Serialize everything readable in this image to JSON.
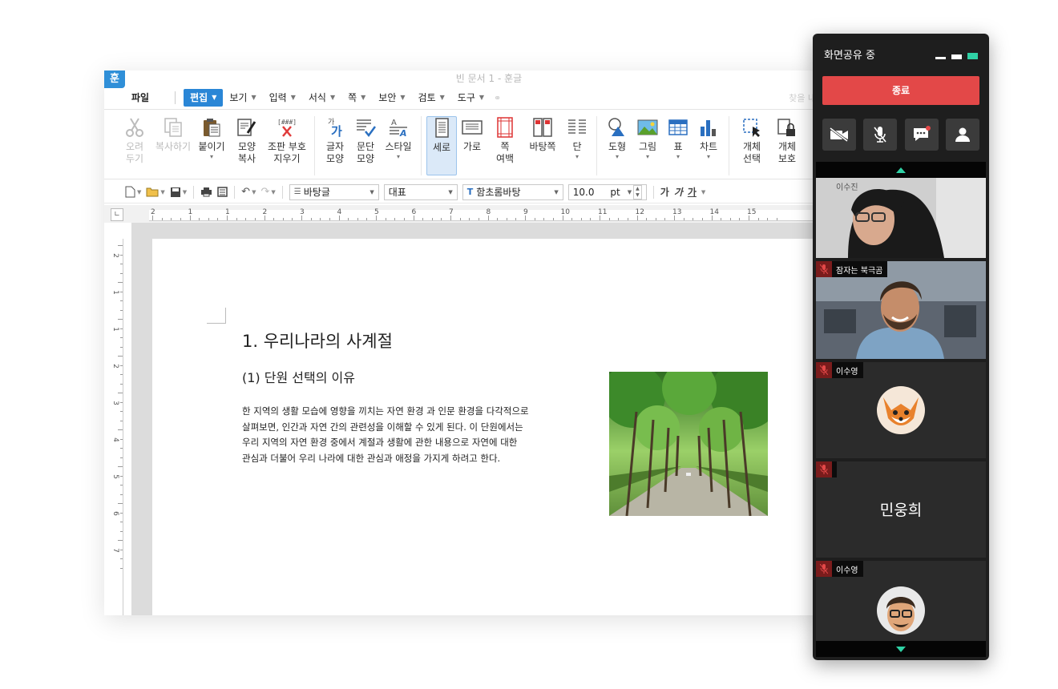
{
  "window": {
    "title": "빈 문서 1 - 훈글",
    "logo": "훈"
  },
  "menu": {
    "file": "파일",
    "items": [
      "편집",
      "보기",
      "입력",
      "서식",
      "쪽",
      "보안",
      "검토",
      "도구"
    ],
    "active": "편집",
    "right_hint": "찾을 내"
  },
  "ribbon": {
    "cut": "오려\n두기",
    "copy": "복사하기",
    "paste": "붙이기",
    "format_copy": "모양\n복사",
    "clear_marks": "조판 부호\n지우기",
    "char_shape": "글자\n모양",
    "para_shape": "문단\n모양",
    "style": "스타일",
    "portrait": "세로",
    "landscape": "가로",
    "page_margin": "쪽\n여백",
    "master_page": "바탕쪽",
    "columns": "단",
    "shapes": "도형",
    "picture": "그림",
    "table": "표",
    "chart": "차트",
    "obj_select": "개체\n선택",
    "obj_protect": "개체\n보호"
  },
  "toolbar": {
    "para_style": "바탕글",
    "lang": "대표",
    "font": "함초롬바탕",
    "font_size": "10.0",
    "unit": "pt",
    "bold": "가",
    "italic": "가",
    "underline": "가"
  },
  "ruler": {
    "h_numbers": [
      "2",
      "1",
      "1",
      "2",
      "3",
      "4",
      "5",
      "6",
      "7",
      "8",
      "9",
      "10",
      "11",
      "12",
      "13",
      "14",
      "15"
    ],
    "v_numbers": [
      "2",
      "1",
      "1",
      "2",
      "3",
      "4",
      "5",
      "6",
      "7"
    ]
  },
  "document": {
    "heading": "1. 우리나라의 사계절",
    "subheading": "(1) 단원 선택의 이유",
    "paragraph_lines": [
      "한 지역의 생활 모습에 영향을 끼치는 자연 환경 과 인문 환경을 다각적으로",
      "살펴보면, 인간과 자연 간의 관련성을 이해할 수 있게 된다. 이 단원에서는",
      "우리 지역의 자연 환경 중에서 계절과 생활에 관한 내용으로 자연에 대한",
      "관심과 더불어 우리 나라에 대한 관심과 애정을 가지게 하려고 한다."
    ]
  },
  "share_panel": {
    "title": "화면공유 중",
    "end_button": "종료",
    "accent": "#2fd1a5",
    "end_color": "#e34848",
    "participants": [
      {
        "name": "이수진",
        "kind": "video"
      },
      {
        "name": "잠자는 북극곰",
        "kind": "video"
      },
      {
        "name": "이수영",
        "kind": "avatar"
      },
      {
        "name": "민웅희",
        "kind": "name-only"
      },
      {
        "name": "이수영",
        "kind": "avatar"
      }
    ]
  }
}
